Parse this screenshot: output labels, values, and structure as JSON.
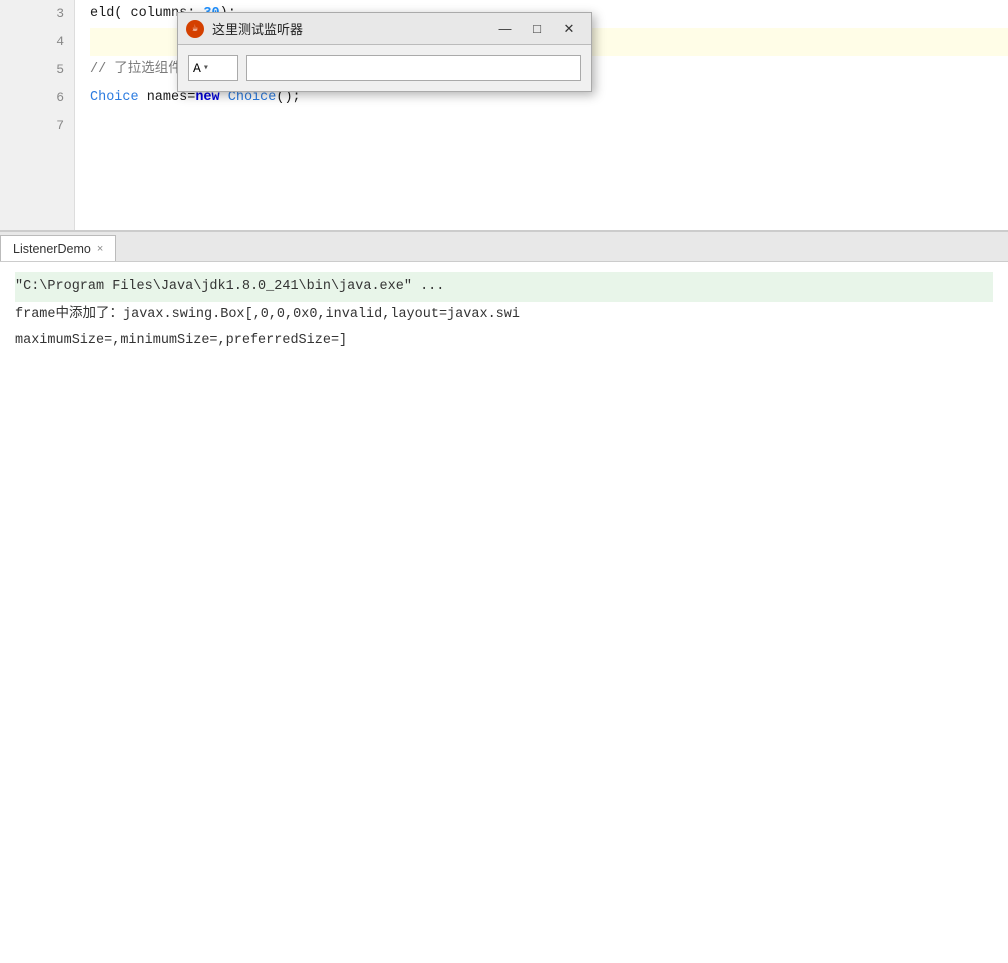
{
  "editor": {
    "lines": [
      {
        "num": "3",
        "content": "",
        "highlighted": false
      },
      {
        "num": "4",
        "content": "",
        "highlighted": true
      },
      {
        "num": "5",
        "content": "",
        "highlighted": false
      },
      {
        "num": "6",
        "content": "",
        "highlighted": false
      },
      {
        "num": "7",
        "content": "",
        "highlighted": false
      }
    ],
    "code_line3": "eld( columns: 30);",
    "code_line4_prefix": "// 了拉选组件",
    "code_line6": "Choice names=new Choice();",
    "columns_number": "30"
  },
  "java_window": {
    "title": "这里测试监听器",
    "icon": "☕",
    "minimize_label": "—",
    "maximize_label": "□",
    "close_label": "✕",
    "dropdown_value": "A",
    "dropdown_arrow": "▾"
  },
  "console": {
    "tab_label": "ListenerDemo",
    "tab_close": "×",
    "line1": "\"C:\\Program Files\\Java\\jdk1.8.0_241\\bin\\java.exe\" ...",
    "line2": "frame中添加了：javax.swing.Box[,0,0,0x0,invalid,layout=javax.swi",
    "line3": "  maximumSize=,minimumSize=,preferredSize=]"
  }
}
